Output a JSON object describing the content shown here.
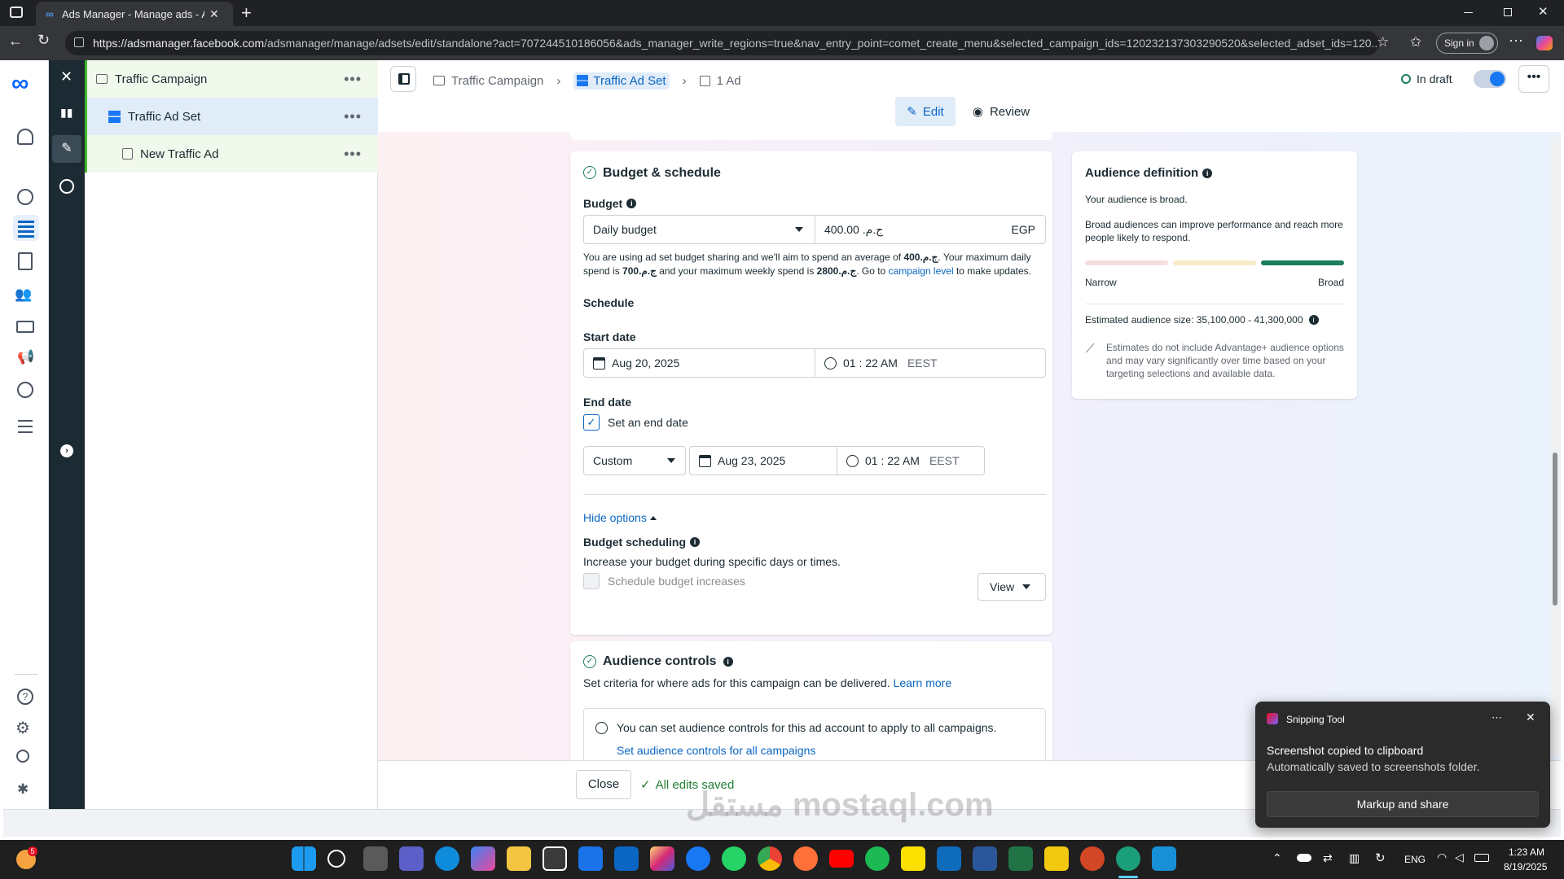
{
  "browser": {
    "tab_title": "Ads Manager - Manage ads - Ad",
    "url_host": "https://adsmanager.facebook.com",
    "url_path": "/adsmanager/manage/adsets/edit/standalone?act=707244510186056&ads_manager_write_regions=true&nav_entry_point=comet_create_menu&selected_campaign_ids=120232137303290520&selected_adset_ids=120...",
    "sign_in": "Sign in"
  },
  "tree": {
    "campaign": "Traffic Campaign",
    "adset": "Traffic Ad Set",
    "ad": "New Traffic Ad"
  },
  "breadcrumb": {
    "campaign": "Traffic Campaign",
    "adset": "Traffic Ad Set",
    "ad": "1 Ad"
  },
  "status": "In draft",
  "modes": {
    "edit": "Edit",
    "review": "Review"
  },
  "budget": {
    "section_title": "Budget & schedule",
    "budget_label": "Budget",
    "budget_type": "Daily budget",
    "amount": "ج.م.‏ 400.00",
    "currency": "EGP",
    "note_1": "You are using ad set budget sharing and we'll aim to spend an average of ",
    "note_avg": "400ج.م.‏",
    "note_2": ". Your maximum daily spend is ",
    "note_max_daily": "700ج.م.‏",
    "note_3": " and your maximum weekly spend is ",
    "note_max_weekly": "2800ج.م.‏",
    "note_4": ". Go to ",
    "note_link": "campaign level",
    "note_5": " to make updates.",
    "schedule_label": "Schedule",
    "start_label": "Start date",
    "start_date": "Aug 20, 2025",
    "start_time": "01 : 22 AM",
    "start_tz": "EEST",
    "end_label": "End date",
    "end_checkbox": "Set an end date",
    "end_mode": "Custom",
    "end_date": "Aug 23, 2025",
    "end_time": "01 : 22 AM",
    "end_tz": "EEST",
    "hide_options": "Hide options",
    "scheduling_label": "Budget scheduling",
    "scheduling_desc": "Increase your budget during specific days or times.",
    "scheduling_checkbox": "Schedule budget increases",
    "view_btn": "View"
  },
  "audience_controls": {
    "title": "Audience controls",
    "desc": "Set criteria for where ads for this campaign can be delivered.",
    "learn_more": "Learn more",
    "info": "You can set audience controls for this ad account to apply to all campaigns.",
    "info_link": "Set audience controls for all campaigns"
  },
  "audience_def": {
    "title": "Audience definition",
    "broad": "Your audience is broad.",
    "desc": "Broad audiences can improve performance and reach more people likely to respond.",
    "narrow": "Narrow",
    "broad_label": "Broad",
    "size": "Estimated audience size: 35,100,000 - 41,300,000",
    "est_1": "Estimates do not include Advantage+ audience options",
    "est_2": " and may vary significantly over time based on your targeting selections and available data."
  },
  "footer": {
    "close": "Close",
    "saved": "All edits saved"
  },
  "toast": {
    "app": "Snipping Tool",
    "title": "Screenshot copied to clipboard",
    "body": "Automatically saved to screenshots folder.",
    "button": "Markup and share"
  },
  "watermark": "مستقل mostaql.com",
  "tray": {
    "lang": "ENG",
    "time": "1:23 AM",
    "date": "8/19/2025",
    "badge": "5"
  },
  "colors": {
    "accent": "#0a66c2",
    "meter_green": "#1b7f5a",
    "saved_green": "#1e7e34"
  }
}
